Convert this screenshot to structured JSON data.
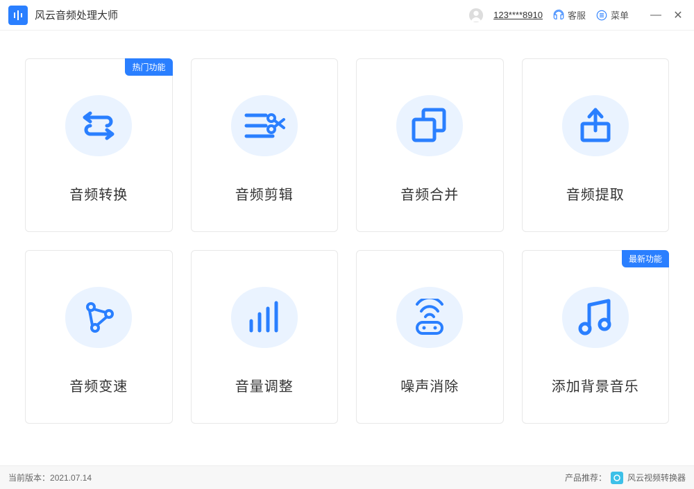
{
  "app": {
    "title": "风云音频处理大师"
  },
  "header": {
    "user_id": "123****8910",
    "service_label": "客服",
    "menu_label": "菜单"
  },
  "badges": {
    "hot": "热门功能",
    "new": "最新功能"
  },
  "cards": [
    {
      "label": "音频转换",
      "icon": "convert-icon",
      "badge": "hot"
    },
    {
      "label": "音频剪辑",
      "icon": "cut-icon",
      "badge": null
    },
    {
      "label": "音频合并",
      "icon": "merge-icon",
      "badge": null
    },
    {
      "label": "音频提取",
      "icon": "extract-icon",
      "badge": null
    },
    {
      "label": "音频变速",
      "icon": "speed-icon",
      "badge": null
    },
    {
      "label": "音量调整",
      "icon": "volume-icon",
      "badge": null
    },
    {
      "label": "噪声消除",
      "icon": "noise-icon",
      "badge": null
    },
    {
      "label": "添加背景音乐",
      "icon": "bgm-icon",
      "badge": "new"
    }
  ],
  "footer": {
    "version_prefix": "当前版本：",
    "version": "2021.07.14",
    "recommend_prefix": "产品推荐：",
    "recommend_product": "风云视频转换器"
  }
}
